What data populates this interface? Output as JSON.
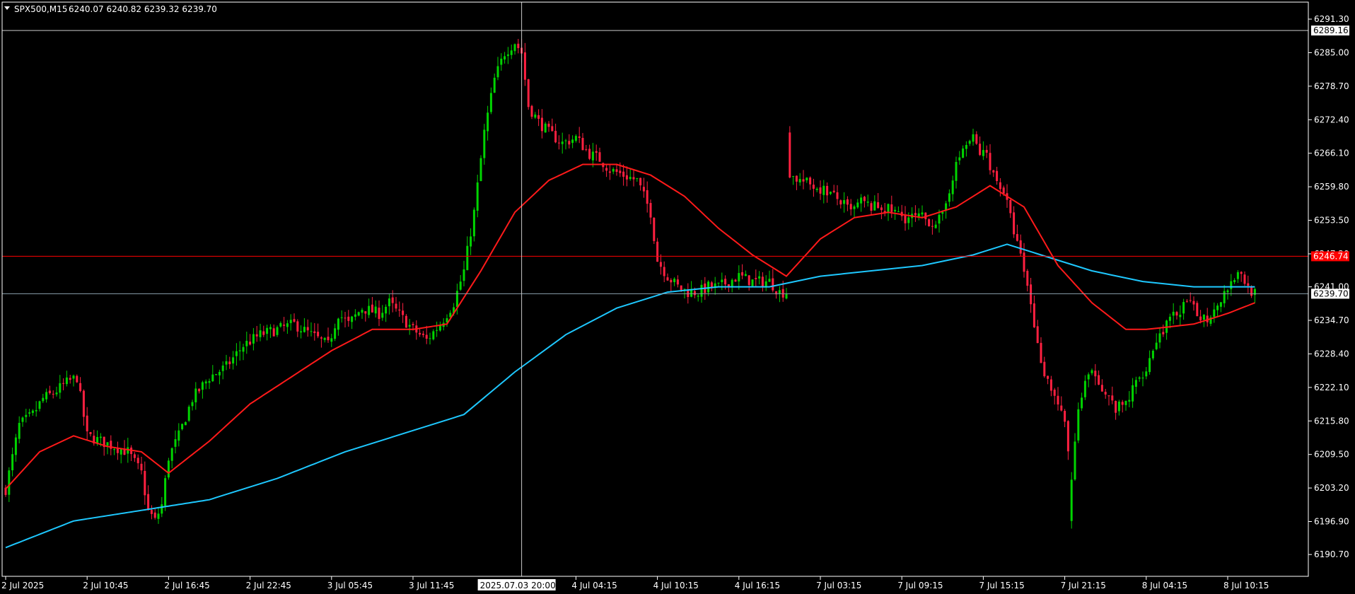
{
  "header": {
    "symbol": "SPX500,M15",
    "ohlc": "6240.07 6240.82 6239.32 6239.70"
  },
  "chart_data": {
    "type": "candlestick",
    "grid": false,
    "legend": "none",
    "colors": {
      "background": "#000000",
      "bull": "#00d400",
      "bear": "#ff2040",
      "ma_fast": "#ff1a1a",
      "ma_slow": "#1ec8ff",
      "crosshair": "#c8c8c8",
      "alert_line": "#ff0000",
      "bid_line": "#8aa0ad",
      "axis": "#ffffff"
    },
    "ylim": [
      6187.8,
      6293.3
    ],
    "y_ticks": [
      "6291.30",
      "6285.00",
      "6278.70",
      "6272.40",
      "6266.10",
      "6259.80",
      "6253.50",
      "6247.20",
      "6241.00",
      "6234.70",
      "6228.40",
      "6222.10",
      "6215.80",
      "6209.50",
      "6203.20",
      "6196.90",
      "6190.70"
    ],
    "x_ticks": [
      "2 Jul 2025",
      "2 Jul 10:45",
      "2 Jul 16:45",
      "2 Jul 22:45",
      "3 Jul 05:45",
      "3 Jul 11:45",
      "4 Jul 04:15",
      "4 Jul 10:15",
      "4 Jul 16:15",
      "7 Jul 03:15",
      "7 Jul 09:15",
      "7 Jul 15:15",
      "7 Jul 21:15",
      "8 Jul 04:15",
      "8 Jul 10:15"
    ],
    "x_tick_bar_index": [
      0,
      24,
      48,
      72,
      96,
      120,
      168,
      192,
      216,
      240,
      264,
      288,
      312,
      336,
      360
    ],
    "crosshair": {
      "price": "6289.16",
      "time": "2025.07.03 20:00",
      "bar_index": 152
    },
    "price_lines": [
      {
        "name": "alert",
        "value": 6246.74,
        "label": "6246.74"
      },
      {
        "name": "current",
        "value": 6239.7,
        "label": "6239.70"
      }
    ],
    "anchors": {
      "close": [
        [
          0,
          6203
        ],
        [
          4,
          6215
        ],
        [
          8,
          6217
        ],
        [
          11,
          6220
        ],
        [
          14,
          6221
        ],
        [
          18,
          6223
        ],
        [
          21,
          6224
        ],
        [
          24,
          6213
        ],
        [
          28,
          6212
        ],
        [
          32,
          6211
        ],
        [
          36,
          6210
        ],
        [
          40,
          6206
        ],
        [
          42,
          6199
        ],
        [
          44,
          6197
        ],
        [
          46,
          6200
        ],
        [
          48,
          6209
        ],
        [
          51,
          6213
        ],
        [
          55,
          6220
        ],
        [
          60,
          6224
        ],
        [
          65,
          6226
        ],
        [
          70,
          6230
        ],
        [
          75,
          6232
        ],
        [
          80,
          6233
        ],
        [
          85,
          6234
        ],
        [
          90,
          6232
        ],
        [
          95,
          6230
        ],
        [
          98,
          6236
        ],
        [
          101,
          6234
        ],
        [
          105,
          6237
        ],
        [
          110,
          6236
        ],
        [
          113,
          6238
        ],
        [
          117,
          6235
        ],
        [
          120,
          6233
        ],
        [
          124,
          6231
        ],
        [
          128,
          6234
        ],
        [
          132,
          6238
        ],
        [
          135,
          6244
        ],
        [
          138,
          6255
        ],
        [
          141,
          6270
        ],
        [
          144,
          6280
        ],
        [
          147,
          6285
        ],
        [
          150,
          6287
        ],
        [
          152,
          6285
        ],
        [
          154,
          6275
        ],
        [
          157,
          6272
        ],
        [
          160,
          6270
        ],
        [
          164,
          6268
        ],
        [
          168,
          6269
        ],
        [
          172,
          6266
        ],
        [
          175,
          6265
        ],
        [
          178,
          6263
        ],
        [
          182,
          6262
        ],
        [
          186,
          6261
        ],
        [
          190,
          6255
        ],
        [
          192,
          6246
        ],
        [
          195,
          6243
        ],
        [
          198,
          6241
        ],
        [
          201,
          6240
        ],
        [
          204,
          6240
        ],
        [
          207,
          6241
        ],
        [
          210,
          6241
        ],
        [
          213,
          6242
        ],
        [
          216,
          6243
        ],
        [
          220,
          6242
        ],
        [
          225,
          6242
        ],
        [
          228,
          6240
        ],
        [
          230,
          6240
        ],
        [
          231,
          6262
        ],
        [
          234,
          6261
        ],
        [
          238,
          6260
        ],
        [
          242,
          6259
        ],
        [
          246,
          6257
        ],
        [
          249,
          6255
        ],
        [
          252,
          6257
        ],
        [
          255,
          6256
        ],
        [
          258,
          6256
        ],
        [
          262,
          6255
        ],
        [
          265,
          6254
        ],
        [
          268,
          6254
        ],
        [
          270,
          6254
        ],
        [
          273,
          6253
        ],
        [
          276,
          6254
        ],
        [
          279,
          6262
        ],
        [
          282,
          6267
        ],
        [
          285,
          6269
        ],
        [
          287,
          6266
        ],
        [
          289,
          6266
        ],
        [
          291,
          6262
        ],
        [
          294,
          6259
        ],
        [
          296,
          6254
        ],
        [
          298,
          6249
        ],
        [
          300,
          6244
        ],
        [
          302,
          6238
        ],
        [
          304,
          6230
        ],
        [
          306,
          6225
        ],
        [
          308,
          6222
        ],
        [
          310,
          6219
        ],
        [
          312,
          6215
        ],
        [
          314,
          6205
        ],
        [
          316,
          6218
        ],
        [
          318,
          6223
        ],
        [
          321,
          6225
        ],
        [
          324,
          6221
        ],
        [
          327,
          6218
        ],
        [
          330,
          6219
        ],
        [
          333,
          6223
        ],
        [
          336,
          6226
        ],
        [
          339,
          6231
        ],
        [
          342,
          6234
        ],
        [
          345,
          6236
        ],
        [
          348,
          6238
        ],
        [
          351,
          6236
        ],
        [
          354,
          6235
        ],
        [
          357,
          6238
        ],
        [
          360,
          6241
        ],
        [
          363,
          6244
        ],
        [
          366,
          6241
        ],
        [
          368,
          6239.7
        ]
      ],
      "ma_fast": [
        [
          0,
          6203
        ],
        [
          10,
          6210
        ],
        [
          20,
          6213
        ],
        [
          30,
          6211
        ],
        [
          40,
          6210
        ],
        [
          48,
          6206
        ],
        [
          60,
          6212
        ],
        [
          72,
          6219
        ],
        [
          84,
          6224
        ],
        [
          96,
          6229
        ],
        [
          108,
          6233
        ],
        [
          120,
          6233
        ],
        [
          130,
          6234
        ],
        [
          140,
          6244
        ],
        [
          150,
          6255
        ],
        [
          160,
          6261
        ],
        [
          170,
          6264
        ],
        [
          180,
          6264
        ],
        [
          190,
          6262
        ],
        [
          200,
          6258
        ],
        [
          210,
          6252
        ],
        [
          220,
          6247
        ],
        [
          230,
          6243
        ],
        [
          240,
          6250
        ],
        [
          250,
          6254
        ],
        [
          260,
          6255
        ],
        [
          270,
          6254
        ],
        [
          280,
          6256
        ],
        [
          290,
          6260
        ],
        [
          300,
          6256
        ],
        [
          310,
          6245
        ],
        [
          320,
          6238
        ],
        [
          330,
          6233
        ],
        [
          336,
          6233
        ],
        [
          350,
          6234
        ],
        [
          360,
          6236
        ],
        [
          368,
          6238
        ]
      ],
      "ma_slow": [
        [
          0,
          6192
        ],
        [
          20,
          6197
        ],
        [
          40,
          6199
        ],
        [
          60,
          6201
        ],
        [
          80,
          6205
        ],
        [
          100,
          6210
        ],
        [
          120,
          6214
        ],
        [
          135,
          6217
        ],
        [
          150,
          6225
        ],
        [
          165,
          6232
        ],
        [
          180,
          6237
        ],
        [
          195,
          6240
        ],
        [
          210,
          6241
        ],
        [
          225,
          6241
        ],
        [
          240,
          6243
        ],
        [
          255,
          6244
        ],
        [
          270,
          6245
        ],
        [
          285,
          6247
        ],
        [
          295,
          6249
        ],
        [
          305,
          6247
        ],
        [
          320,
          6244
        ],
        [
          335,
          6242
        ],
        [
          350,
          6241
        ],
        [
          368,
          6241
        ]
      ]
    },
    "bar_count": 369
  }
}
